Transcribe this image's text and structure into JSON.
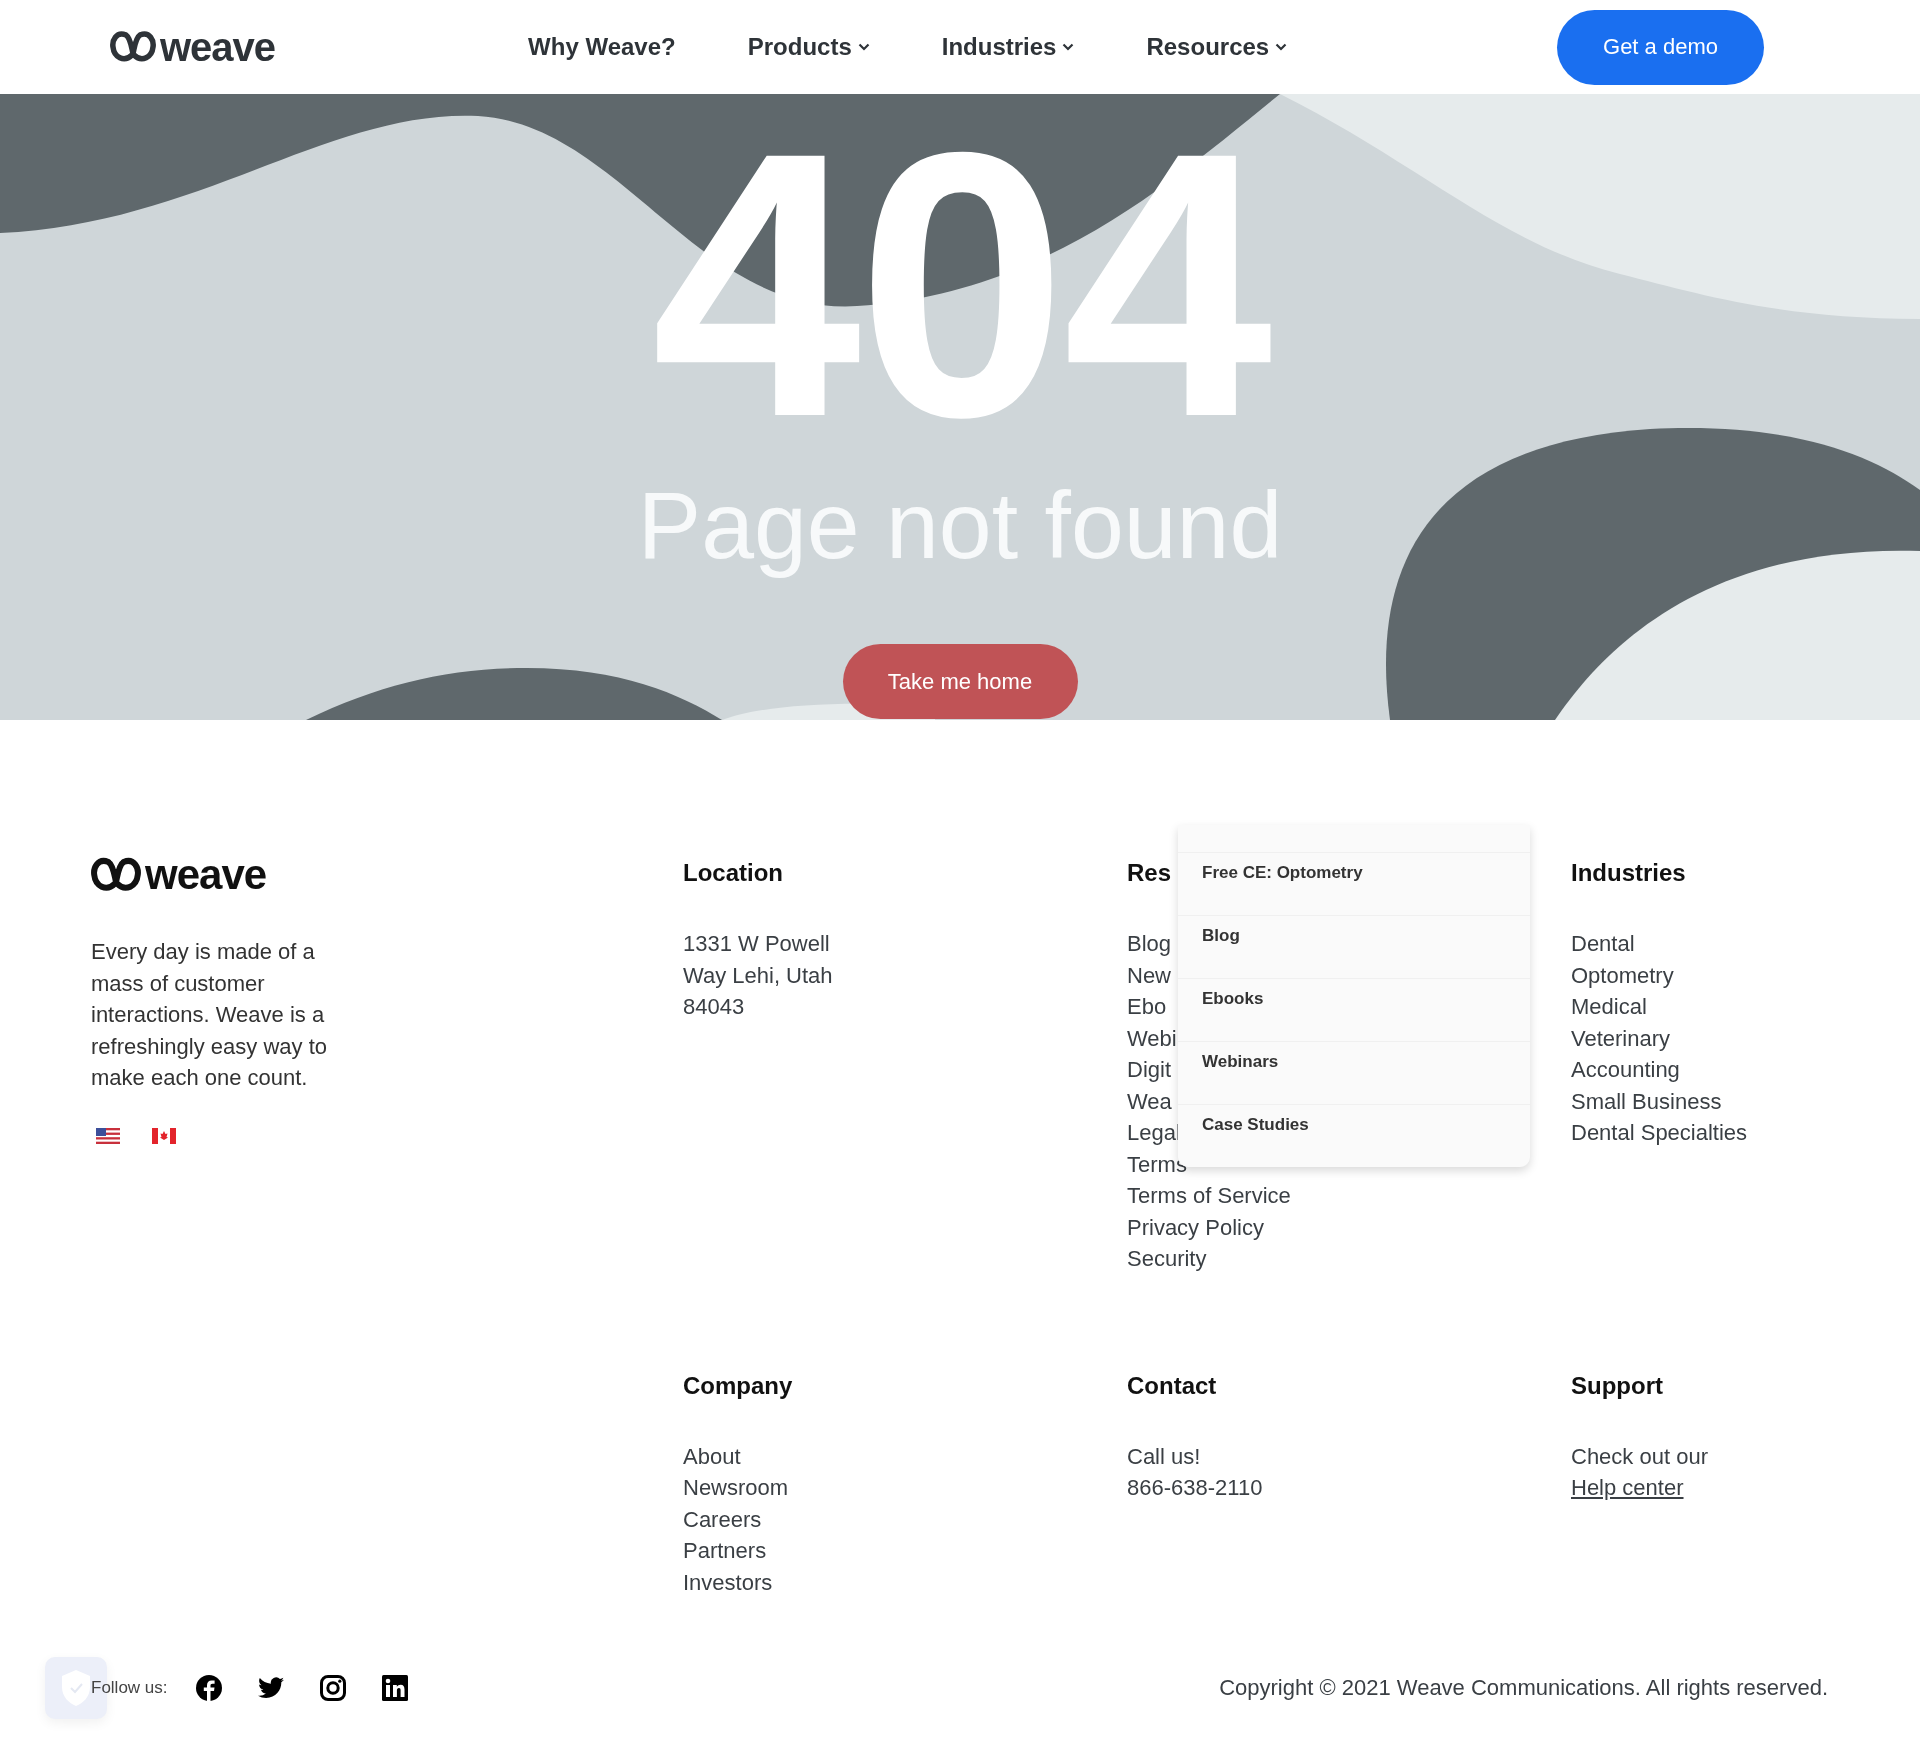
{
  "header": {
    "logo": "weave",
    "nav": [
      {
        "label": "Why Weave?",
        "dropdown": false
      },
      {
        "label": "Products",
        "dropdown": true
      },
      {
        "label": "Industries",
        "dropdown": true
      },
      {
        "label": "Resources",
        "dropdown": true
      }
    ],
    "cta": "Get a demo"
  },
  "hero": {
    "code": "404",
    "message": "Page not found",
    "button": "Take me home"
  },
  "footer": {
    "logo": "weave",
    "tagline": "Every day is made of a mass of customer interactions. Weave is a refreshingly easy way to make each one count.",
    "columns": [
      {
        "heading": "Location",
        "lines": [
          {
            "text": "1331 W Powell Way Lehi, Utah 84043",
            "kind": "text"
          }
        ]
      },
      {
        "heading": "Res",
        "lines": [
          {
            "text": "Blog",
            "kind": "link"
          },
          {
            "text": "New",
            "kind": "link"
          },
          {
            "text": "Ebo",
            "kind": "link"
          },
          {
            "text": "Webi",
            "kind": "link"
          },
          {
            "text": "Digit",
            "kind": "link"
          },
          {
            "text": "Wea",
            "kind": "link"
          },
          {
            "text": "Legal",
            "kind": "link"
          },
          {
            "text": "Terms",
            "kind": "link"
          },
          {
            "text": "Terms of Service",
            "kind": "link"
          },
          {
            "text": "Privacy Policy",
            "kind": "link"
          },
          {
            "text": "Security",
            "kind": "link"
          }
        ],
        "menu": [
          "Free CE: Optometry",
          "Blog",
          "Ebooks",
          "Webinars",
          "Case Studies"
        ]
      },
      {
        "heading": "Industries",
        "lines": [
          {
            "text": "Dental",
            "kind": "link"
          },
          {
            "text": "Optometry",
            "kind": "link"
          },
          {
            "text": "Medical",
            "kind": "link"
          },
          {
            "text": "Veterinary",
            "kind": "link"
          },
          {
            "text": "Accounting",
            "kind": "link"
          },
          {
            "text": "Small Business",
            "kind": "link"
          },
          {
            "text": "Dental Specialties",
            "kind": "link"
          }
        ]
      },
      {
        "heading": "Company",
        "lines": [
          {
            "text": "About",
            "kind": "link"
          },
          {
            "text": "Newsroom",
            "kind": "link"
          },
          {
            "text": "Careers",
            "kind": "link"
          },
          {
            "text": "Partners",
            "kind": "link"
          },
          {
            "text": "Investors",
            "kind": "link"
          }
        ]
      },
      {
        "heading": "Contact",
        "lines": [
          {
            "text": "Call us!",
            "kind": "text"
          },
          {
            "text": "866-638-2110",
            "kind": "link"
          }
        ]
      },
      {
        "heading": "Support",
        "lines": [
          {
            "text": "Check out our",
            "kind": "text"
          },
          {
            "text": "Help center",
            "kind": "underlined"
          }
        ]
      }
    ],
    "follow": "Follow us:",
    "copyright": "Copyright © 2021 Weave Communications. All rights reserved."
  }
}
